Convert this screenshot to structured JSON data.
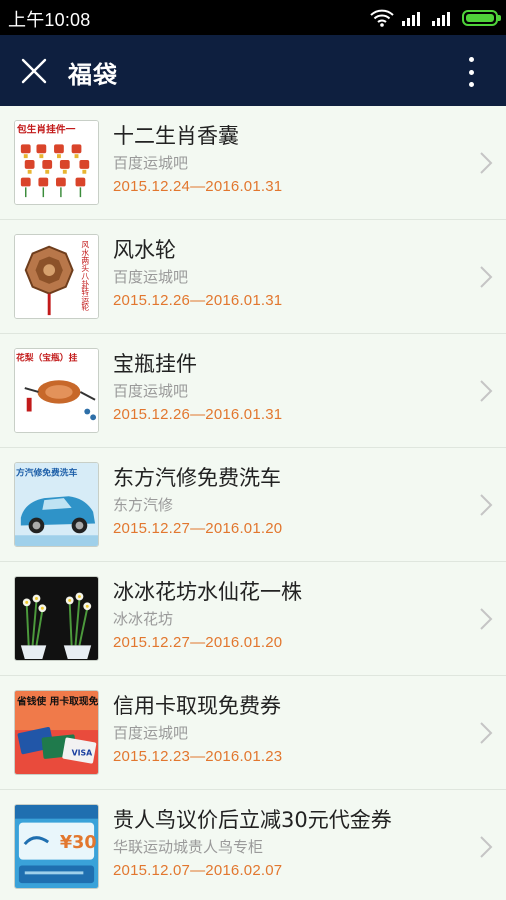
{
  "status_bar": {
    "time": "上午10:08",
    "icons": [
      "wifi-icon",
      "signal-icon",
      "signal-icon",
      "battery-icon"
    ]
  },
  "header": {
    "title": "福袋",
    "close_icon": "close-icon",
    "more_icon": "more-vertical-icon",
    "background": "#0e1f3f"
  },
  "colors": {
    "date": "#e2772f",
    "shop": "#9a9a9a",
    "title": "#222222",
    "page_background": "#f3f9f2"
  },
  "items": [
    {
      "title": "十二生肖香囊",
      "shop": "百度运城吧",
      "date": "2015.12.24—2016.01.31",
      "thumb_label": "包生肖挂件一"
    },
    {
      "title": "风水轮",
      "shop": "百度运城吧",
      "date": "2015.12.26—2016.01.31",
      "thumb_label": "风水两头八卦转运轮"
    },
    {
      "title": "宝瓶挂件",
      "shop": "百度运城吧",
      "date": "2015.12.26—2016.01.31",
      "thumb_label": "花梨（宝瓶）挂"
    },
    {
      "title": "东方汽修免费洗车",
      "shop": "东方汽修",
      "date": "2015.12.27—2016.01.20",
      "thumb_label": "方汽修免费洗车"
    },
    {
      "title": "冰冰花坊水仙花一株",
      "shop": "冰冰花坊",
      "date": "2015.12.27—2016.01.20",
      "thumb_label": ""
    },
    {
      "title": "信用卡取现免费券",
      "shop": "百度运城吧",
      "date": "2015.12.23—2016.01.23",
      "thumb_label": "省钱使 用卡取现免"
    },
    {
      "title": "贵人鸟议价后立减30元代金券",
      "shop": "华联运动城贵人鸟专柜",
      "date": "2015.12.07—2016.02.07",
      "thumb_label": "¥30"
    }
  ]
}
